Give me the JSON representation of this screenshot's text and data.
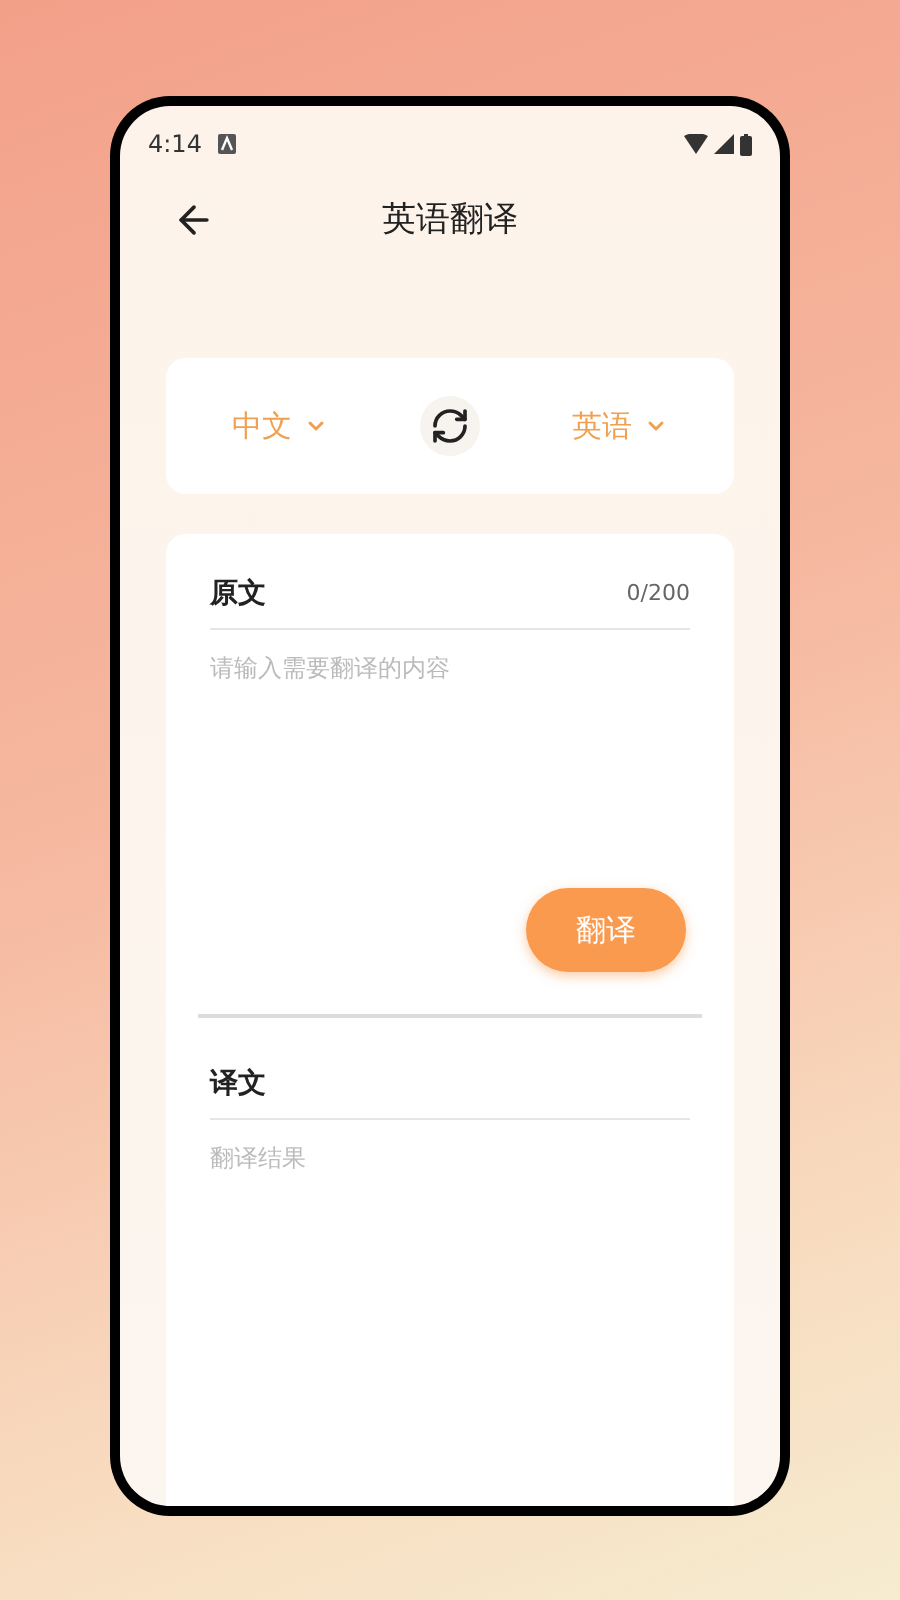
{
  "status_bar": {
    "time": "4:14"
  },
  "header": {
    "title": "英语翻译"
  },
  "languages": {
    "source": "中文",
    "target": "英语"
  },
  "source": {
    "label": "原文",
    "count": "0/200",
    "placeholder": "请输入需要翻译的内容",
    "button": "翻译"
  },
  "result": {
    "label": "译文",
    "placeholder": "翻译结果"
  }
}
